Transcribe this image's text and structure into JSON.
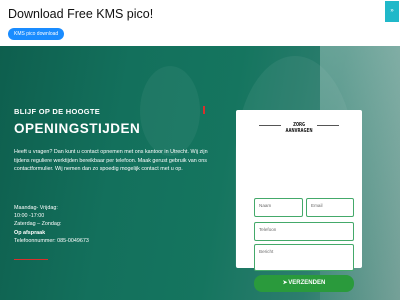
{
  "top": {
    "title": "Download Free KMS pico!",
    "button_label": "KMS pico download",
    "side_tab": "»"
  },
  "hero": {
    "eyebrow": "BLIJF OP DE HOOGTE",
    "heading": "OPENINGSTIJDEN",
    "description": "Heeft u vragen? Dan kunt u contact opnemen met ons kantoor in Utrecht. Wij zijn tijdens reguliere werktijden bereikbaar per telefoon. Maak gerust gebruik van ons contactformulier. Wij nemen dan zo spoedig mogelijk contact met u op.",
    "hours": {
      "weekdays_label": "Maandag- Vrijdag:",
      "weekdays_time": "10:00 -17:00",
      "weekend_label": "Zaterdag – Zondag:",
      "weekend_time": "Op afspraak",
      "phone": "Telefoonnummer: 085-0049673"
    }
  },
  "form": {
    "title_line1": "ZORG",
    "title_line2": "AANVRAGEN",
    "name_placeholder": "Naam",
    "email_placeholder": "Email",
    "phone_placeholder": "Telefoon",
    "message_placeholder": "Bericht",
    "submit_label": "VERZENDEN",
    "send_icon": "paper-plane-icon"
  },
  "colors": {
    "hero_green": "#13705c",
    "button_green": "#2a9a3c",
    "field_border": "#44a96a",
    "accent_red": "#d9302c",
    "top_button_blue": "#1a8cff",
    "side_tab_teal": "#20b8c9"
  }
}
